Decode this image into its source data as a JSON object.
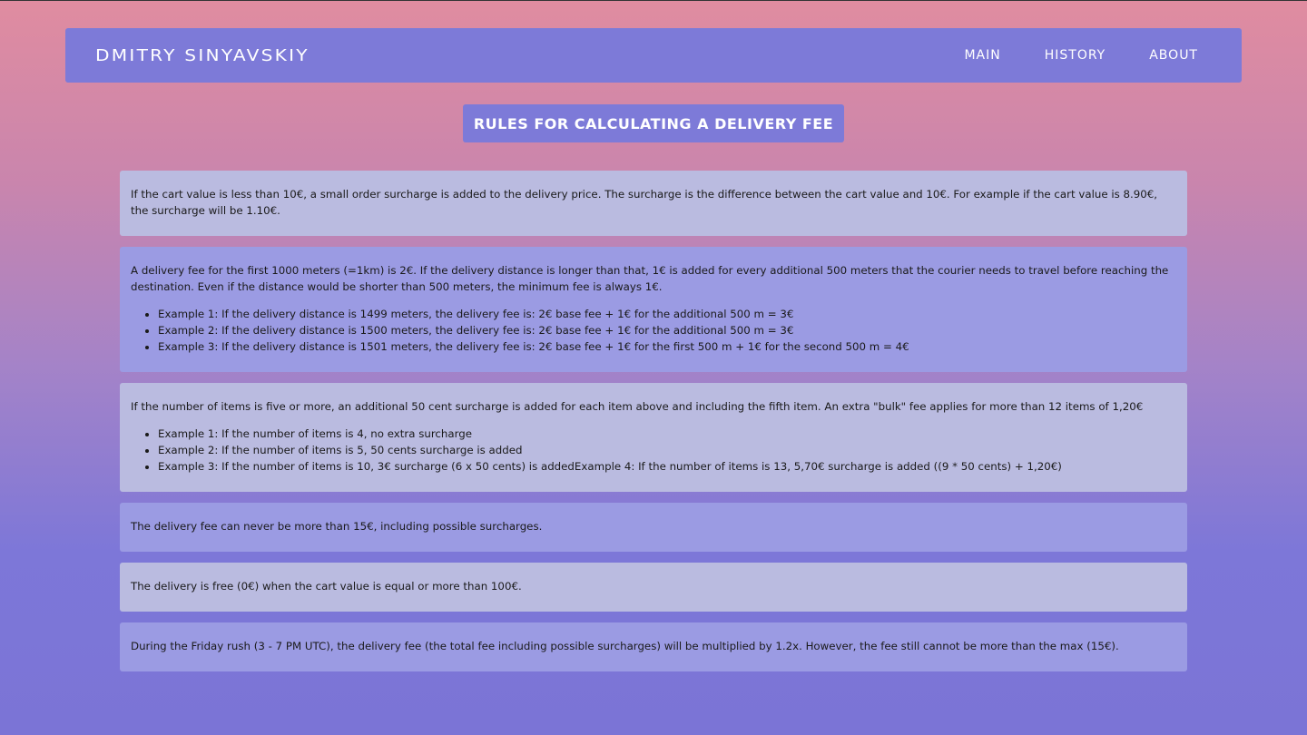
{
  "header": {
    "brand": "DMITRY SINYAVSKIY",
    "nav": [
      "MAIN",
      "HISTORY",
      "ABOUT"
    ]
  },
  "page_title": "RULES FOR CALCULATING A DELIVERY FEE",
  "rules": [
    {
      "text": "If the cart value is less than 10€, a small order surcharge is added to the delivery price. The surcharge is the difference between the cart value and 10€. For example if the cart value is 8.90€, the surcharge will be 1.10€.",
      "examples": []
    },
    {
      "text": "A delivery fee for the first 1000 meters (=1km) is 2€. If the delivery distance is longer than that, 1€ is added for every additional 500 meters that the courier needs to travel before reaching the destination. Even if the distance would be shorter than 500 meters, the minimum fee is always 1€.",
      "examples": [
        "Example 1: If the delivery distance is 1499 meters, the delivery fee is: 2€ base fee + 1€ for the additional 500 m = 3€",
        "Example 2: If the delivery distance is 1500 meters, the delivery fee is: 2€ base fee + 1€ for the additional 500 m = 3€",
        "Example 3: If the delivery distance is 1501 meters, the delivery fee is: 2€ base fee + 1€ for the first 500 m + 1€ for the second 500 m = 4€"
      ]
    },
    {
      "text": "If the number of items is five or more, an additional 50 cent surcharge is added for each item above and including the fifth item. An extra \"bulk\" fee applies for more than 12 items of 1,20€",
      "examples": [
        "Example 1: If the number of items is 4, no extra surcharge",
        "Example 2: If the number of items is 5, 50 cents surcharge is added",
        "Example 3: If the number of items is 10, 3€ surcharge (6 x 50 cents) is addedExample 4: If the number of items is 13, 5,70€ surcharge is added ((9 * 50 cents) + 1,20€)"
      ]
    },
    {
      "text": "The delivery fee can never be more than 15€, including possible surcharges.",
      "examples": []
    },
    {
      "text": "The delivery is free (0€) when the cart value is equal or more than 100€.",
      "examples": []
    },
    {
      "text": "During the Friday rush (3 - 7 PM UTC), the delivery fee (the total fee including possible surcharges) will be multiplied by 1.2x. However, the fee still cannot be more than the max (15€).",
      "examples": []
    }
  ],
  "colors": {
    "navbar": "#7d7ad8",
    "card_light": "#babbe0",
    "card_mid": "#9b9be3"
  }
}
